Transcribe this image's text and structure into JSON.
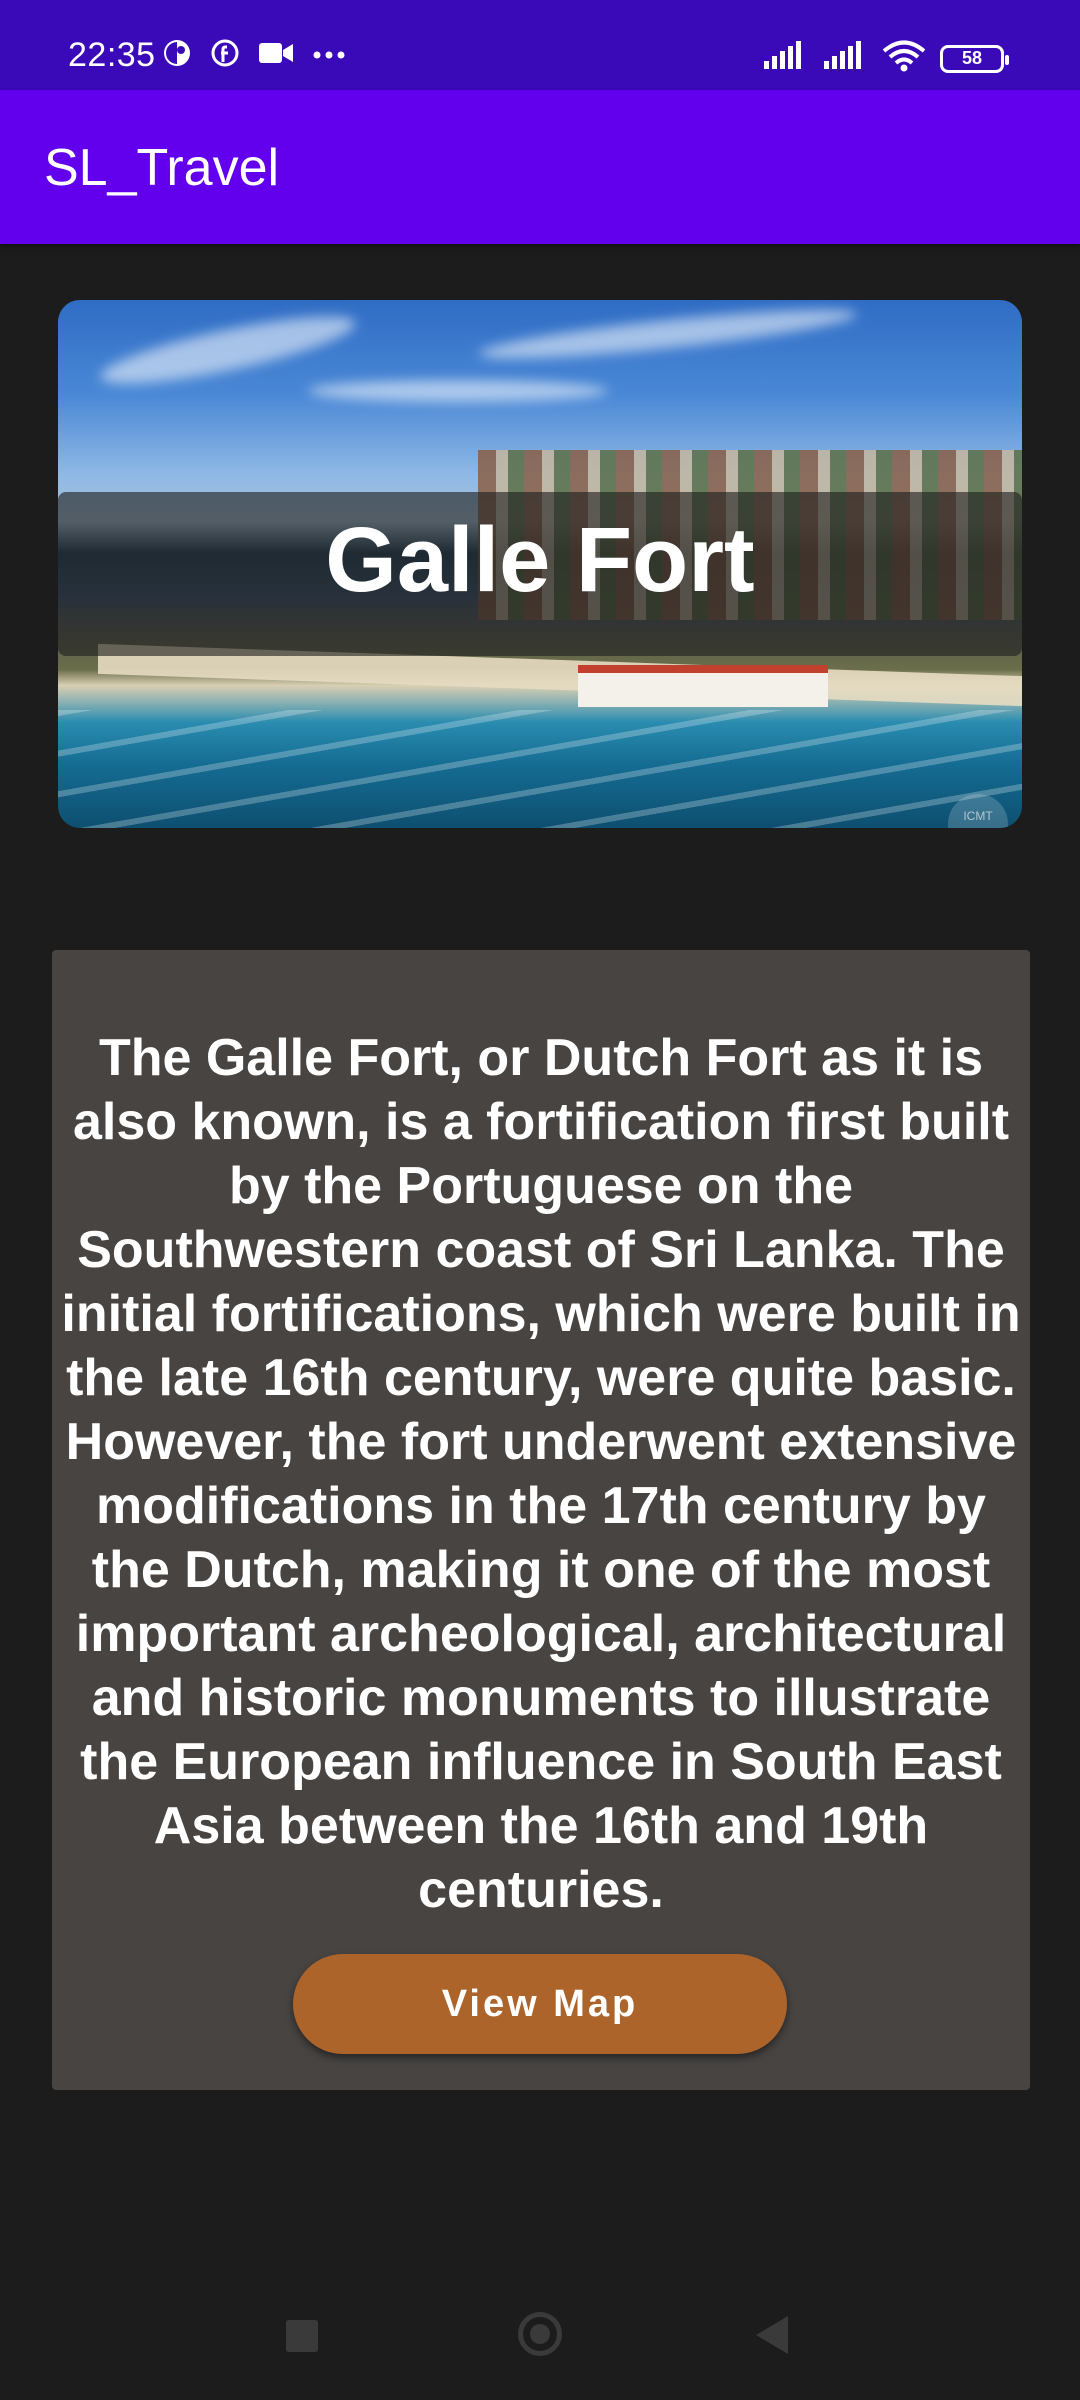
{
  "status_bar": {
    "time": "22:35",
    "left_icons": [
      "moon-clock-icon",
      "facebook-icon",
      "video-camera-icon",
      "more-dots-icon"
    ],
    "right_icons": [
      "signal-icon",
      "signal-icon",
      "wifi-icon"
    ],
    "battery": "58"
  },
  "app_bar": {
    "title": "SL_Travel"
  },
  "hero": {
    "title": "Galle Fort",
    "watermark": "ICMT"
  },
  "description": {
    "text": "The Galle Fort, or Dutch Fort as it is also known, is a fortification first built by the Portuguese on the Southwestern coast of Sri Lanka. The initial fortifications, which were built in the late 16th century, were quite basic. However, the fort underwent extensive modifications in the 17th century by the Dutch, making it one of the most important archeological, architectural and historic monuments to illustrate the European influence in South East Asia between the 16th and 19th centuries."
  },
  "actions": {
    "view_map_label": "View Map"
  },
  "nav_bar": {
    "buttons": [
      "recents-icon",
      "home-icon",
      "back-icon"
    ]
  },
  "colors": {
    "status_bar": "#3b0ab8",
    "app_bar": "#6200ee",
    "background": "#1c1c1c",
    "card": "#474442",
    "button": "#ad642a"
  }
}
